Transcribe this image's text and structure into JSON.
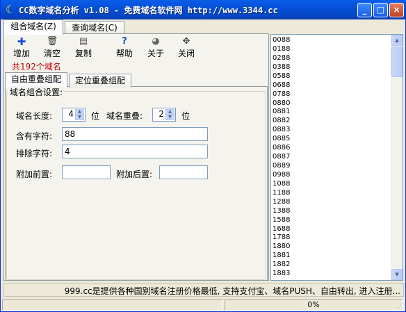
{
  "window": {
    "title": "CC数字域名分析 v1.08 - 免费域名软件网 http://www.3344.cc",
    "min_label": "_",
    "max_label": "□",
    "close_label": "×"
  },
  "main_tabs": [
    {
      "label": "组合域名(Z)"
    },
    {
      "label": "查询域名(C)"
    }
  ],
  "toolbar": {
    "add": "增加",
    "clear": "清空",
    "copy": "复制",
    "help": "帮助",
    "about": "关于",
    "close": "关闭"
  },
  "domain_count": "共192个域名",
  "sub_tabs": [
    {
      "label": "自由重叠组配"
    },
    {
      "label": "定位重叠组配"
    }
  ],
  "settings": {
    "group_title": "域名组合设置:",
    "length_label": "域名长度:",
    "length_value": "4",
    "length_unit": "位",
    "overlap_label": "域名重叠:",
    "overlap_value": "2",
    "overlap_unit": "位",
    "contains_label": "含有字符:",
    "contains_value": "88",
    "exclude_label": "排除字符:",
    "exclude_value": "4",
    "prefix_label": "附加前置:",
    "prefix_value": "",
    "suffix_label": "附加后置:",
    "suffix_value": ""
  },
  "domain_list": [
    "0088",
    "0188",
    "0288",
    "0388",
    "0588",
    "0688",
    "0788",
    "0880",
    "0881",
    "0882",
    "0883",
    "0885",
    "0886",
    "0887",
    "0889",
    "0988",
    "1088",
    "1188",
    "1288",
    "1388",
    "1588",
    "1688",
    "1788",
    "1880",
    "1881",
    "1882",
    "1883"
  ],
  "marquee": "999.cc是提供各种国别域名注册价格最低, 支持支付宝、域名PUSH、自由转出, 进入注册...",
  "status": {
    "progress": "0%"
  },
  "colors": {
    "titlebar": "#0550d8",
    "count_text": "#c00000",
    "window_bg": "#ece9d8"
  }
}
